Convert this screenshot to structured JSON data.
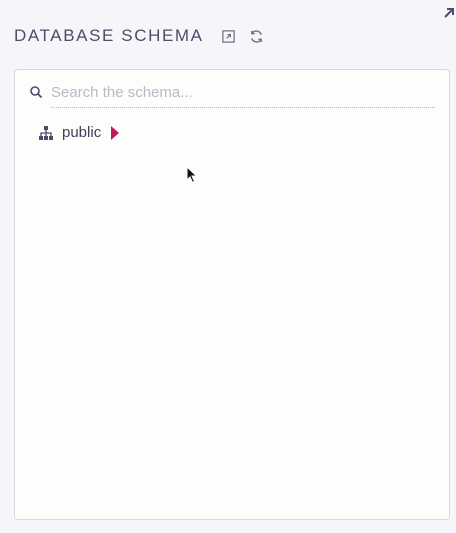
{
  "header": {
    "title": "DATABASE SCHEMA",
    "icons": [
      "expand-icon",
      "refresh-icon"
    ]
  },
  "search": {
    "placeholder": "Search the schema...",
    "value": ""
  },
  "tree": {
    "items": [
      {
        "label": "public",
        "icon": "schema-tree-icon",
        "expanded": false
      }
    ]
  },
  "colors": {
    "accent": "#c2185b",
    "text": "#4b4d68",
    "background": "#f6f6fa",
    "panel": "#fdfdfc"
  }
}
